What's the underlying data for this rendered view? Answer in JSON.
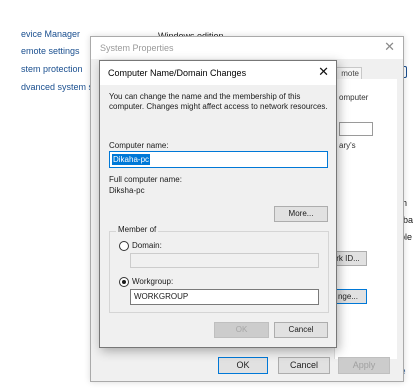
{
  "control_panel": {
    "links": [
      "evice Manager",
      "emote settings",
      "stem protection",
      "dvanced system se"
    ],
    "windows_edition": "Windows edition",
    "right_link": "ce"
  },
  "system_properties": {
    "title": "System Properties",
    "tab_label": "mote",
    "text_computer": "omputer",
    "text_ary": "ary's",
    "network_id_button": "rk ID...",
    "change_button": "nge...",
    "ok_label": "OK",
    "cancel_label": "Cancel",
    "apply_label": "Apply"
  },
  "dialog": {
    "title": "Computer Name/Domain Changes",
    "description": "You can change the name and the membership of this computer. Changes might affect access to network resources.",
    "computer_name_label": "Computer name:",
    "computer_name_value": "Dikaha-pc",
    "full_name_label": "Full computer name:",
    "full_name_value": "Diksha-pc",
    "more_button": "More...",
    "member_of_label": "Member of",
    "domain_label": "Domain:",
    "domain_value": "",
    "workgroup_label": "Workgroup:",
    "workgroup_value": "WORKGROUP",
    "ok_label": "OK",
    "cancel_label": "Cancel"
  },
  "selected_member": "workgroup"
}
